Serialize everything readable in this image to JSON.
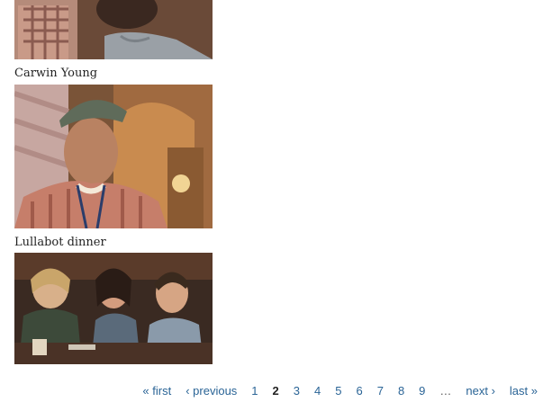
{
  "gallery": {
    "items": [
      {
        "caption": "",
        "photo": "person-in-plaid-shirt-photo"
      },
      {
        "caption": "Carwin Young",
        "photo": "man-in-cap-photo"
      },
      {
        "caption": "Lullabot dinner",
        "photo": "group-dinner-photo"
      }
    ]
  },
  "pager": {
    "first": "« first",
    "previous": "‹ previous",
    "pages": [
      "1",
      "2",
      "3",
      "4",
      "5",
      "6",
      "7",
      "8",
      "9"
    ],
    "current": "2",
    "ellipsis": "…",
    "next": "next ›",
    "last": "last »"
  },
  "colors": {
    "link": "#2a6496",
    "text": "#222222",
    "background": "#ffffff"
  }
}
